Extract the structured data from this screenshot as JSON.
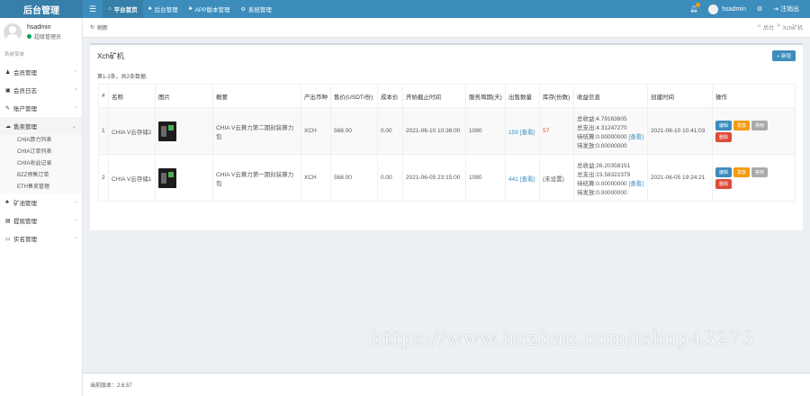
{
  "app": {
    "title": "后台管理"
  },
  "topnav": [
    {
      "label": "平台首页",
      "icon": "house-icon",
      "glyph": "⌂",
      "active": true
    },
    {
      "label": "后台管理",
      "icon": "users-icon",
      "glyph": "♣",
      "active": false
    },
    {
      "label": "APP版本管理",
      "icon": "users-icon",
      "glyph": "♣",
      "active": false
    },
    {
      "label": "系统管理",
      "icon": "gears-icon",
      "glyph": "⚙",
      "active": false
    }
  ],
  "topright": {
    "username": "hsadmin",
    "logout": "注销出"
  },
  "user": {
    "name": "hsadmin",
    "role": "超级管理员"
  },
  "sidebar": {
    "header": "系统菜单",
    "items": [
      {
        "label": "会员管理",
        "glyph": "♟"
      },
      {
        "label": "会员日志",
        "glyph": "▣"
      },
      {
        "label": "账户管理",
        "glyph": "✎"
      },
      {
        "label": "售卖管理",
        "glyph": "☁"
      }
    ],
    "subitems": [
      "CHIA算力列表",
      "CHIA订单列表",
      "CHIA收益记录",
      "BZZ预售订单",
      "ETH售卖管理"
    ],
    "items_after": [
      {
        "label": "矿池管理",
        "glyph": "♣"
      },
      {
        "label": "提现管理",
        "glyph": "▤"
      },
      {
        "label": "实名管理",
        "glyph": "▭"
      }
    ]
  },
  "crumbbar": {
    "refresh": "刷新",
    "home": "后台",
    "sep": ">",
    "current": "Xch矿机"
  },
  "box": {
    "title": "Xch矿机",
    "add": "+ 新增",
    "summary": "第1-2条，共2条数据."
  },
  "table": {
    "headers": [
      "#",
      "名称",
      "图片",
      "概要",
      "产出币种",
      "售价(USDT/份)",
      "成本价",
      "开始截止时间",
      "服务周期(天)",
      "出售数量",
      "库存(份数)",
      "收益信息",
      "创建时间",
      "操作"
    ],
    "rows": [
      {
        "index": "1",
        "name": "CHIA V云存储2",
        "summary": "CHIA V云算力第二期封装算力包",
        "coin": "XCH",
        "price": "568.00",
        "cost": "0.00",
        "time": "2021-06-10 10:36:00",
        "period": "1080",
        "sold": "159",
        "sold_link": "[查看]",
        "stock": "57",
        "income1": "总收益:4.79163605",
        "income2": "总支出:4.31247270",
        "income3": "待结算:0.00000000",
        "income_link": "[查看]",
        "income4": "待发放:0.00000000",
        "created": "2021-06-10 10:41:03"
      },
      {
        "index": "2",
        "name": "CHIA V云存储1",
        "summary": "CHIA V云算力第一期封装算力包",
        "coin": "XCH",
        "price": "568.00",
        "cost": "0.00",
        "time": "2021-06-05 23:15:00",
        "period": "1080",
        "sold": "441",
        "sold_link": "[查看]",
        "stock": "(未设置)",
        "income1": "总收益:26.20358151",
        "income2": "总支出:23.58322379",
        "income3": "待结算:0.00000000",
        "income_link": "[查看]",
        "income4": "待发放:0.00000000",
        "created": "2021-06-05 19:24:21"
      }
    ],
    "ops": {
      "edit": "编辑",
      "release": "发放",
      "disable": "禁用",
      "delete": "删除"
    }
  },
  "watermark": "https://www.huzhan.com/ishop43273",
  "footer": {
    "version": "当前版本：2.6.57"
  },
  "colors": {
    "primary": "#3c8dbc",
    "primary_dark": "#367fa9",
    "warning": "#f39c12",
    "danger": "#dd4b39",
    "success": "#00a65a"
  }
}
